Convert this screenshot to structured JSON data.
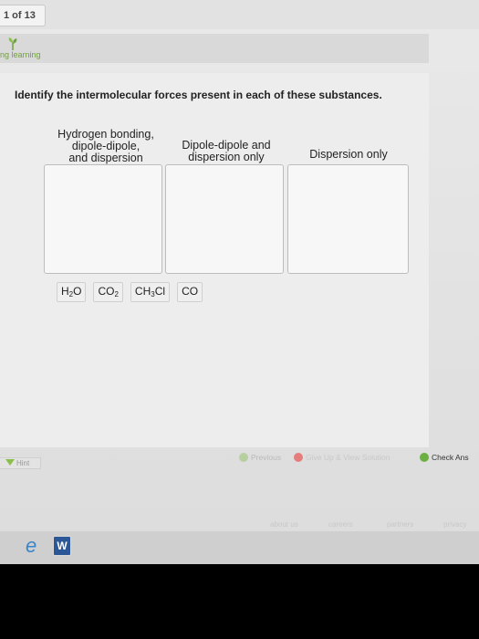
{
  "header": {
    "counter": "1 of 13",
    "brand": "ng learning"
  },
  "question": "Identify the intermolecular forces present in each of these substances.",
  "categories": [
    {
      "lines": [
        "Hydrogen bonding,",
        "dipole-dipole,",
        "and dispersion"
      ]
    },
    {
      "lines": [
        "Dipole-dipole and",
        "dispersion only"
      ]
    },
    {
      "lines": [
        "Dispersion only"
      ]
    }
  ],
  "chips": [
    {
      "main": "H",
      "sub": "2",
      "tail": "O"
    },
    {
      "main": "CO",
      "sub": "2",
      "tail": ""
    },
    {
      "main": "CH",
      "sub": "3",
      "tail": "Cl"
    },
    {
      "main": "CO",
      "sub": "",
      "tail": ""
    }
  ],
  "hint_label": "Hint",
  "actions": {
    "previous": "Previous",
    "give_up": "Give Up & View Solution",
    "check": "Check Ans"
  },
  "footer": [
    "about us",
    "careers",
    "partners",
    "privacy"
  ],
  "taskbar": {
    "word_label": "W"
  },
  "colors": {
    "brand_green": "#6fa23a",
    "check_green": "#6bb043",
    "give_up_red": "#e57d7d"
  }
}
